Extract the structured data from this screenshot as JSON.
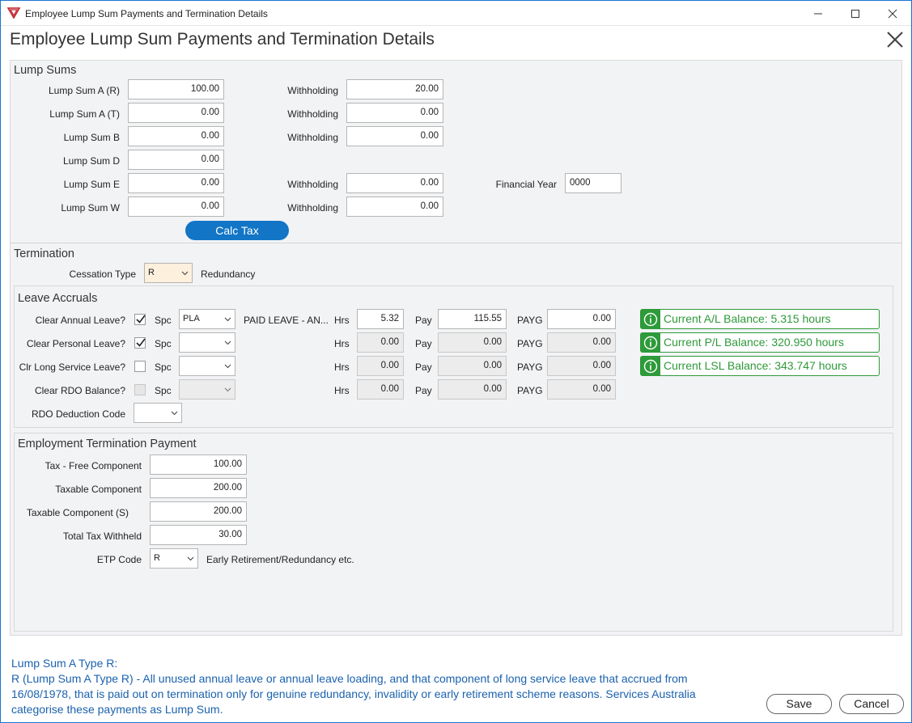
{
  "window": {
    "title": "Employee Lump Sum Payments and Termination Details"
  },
  "header": {
    "title": "Employee Lump Sum Payments and Termination Details"
  },
  "lump_sums": {
    "section_title": "Lump Sums",
    "rows": [
      {
        "label": "Lump Sum A (R)",
        "value": "100.00",
        "withholding_label": "Withholding",
        "withholding": "20.00"
      },
      {
        "label": "Lump Sum A (T)",
        "value": "0.00",
        "withholding_label": "Withholding",
        "withholding": "0.00"
      },
      {
        "label": "Lump Sum B",
        "value": "0.00",
        "withholding_label": "Withholding",
        "withholding": "0.00"
      },
      {
        "label": "Lump Sum D",
        "value": "0.00"
      },
      {
        "label": "Lump Sum E",
        "value": "0.00",
        "withholding_label": "Withholding",
        "withholding": "0.00"
      },
      {
        "label": "Lump Sum W",
        "value": "0.00",
        "withholding_label": "Withholding",
        "withholding": "0.00"
      }
    ],
    "financial_year_label": "Financial Year",
    "financial_year": "0000",
    "calc_tax_label": "Calc Tax"
  },
  "termination": {
    "section_title": "Termination",
    "cessation_type_label": "Cessation Type",
    "cessation_type": "R",
    "cessation_desc": "Redundancy"
  },
  "leave_accruals": {
    "section_title": "Leave Accruals",
    "spc_label": "Spc",
    "hrs_label": "Hrs",
    "pay_label": "Pay",
    "payg_label": "PAYG",
    "rows": [
      {
        "label": "Clear Annual Leave?",
        "checked": true,
        "spc": "PLA",
        "spc_desc": "PAID LEAVE - AN...",
        "hrs": "5.32",
        "pay": "115.55",
        "payg": "0.00",
        "balance": "Current A/L Balance: 5.315 hours"
      },
      {
        "label": "Clear Personal Leave?",
        "checked": true,
        "spc": "",
        "hrs": "0.00",
        "pay": "0.00",
        "payg": "0.00",
        "balance": "Current P/L Balance: 320.950 hours"
      },
      {
        "label": "Clr Long Service Leave?",
        "checked": false,
        "spc": "",
        "hrs": "0.00",
        "pay": "0.00",
        "payg": "0.00",
        "balance": "Current LSL Balance: 343.747 hours"
      },
      {
        "label": "Clear RDO Balance?",
        "checked": false,
        "spc": "",
        "hrs": "0.00",
        "pay": "0.00",
        "payg": "0.00"
      }
    ],
    "rdo_deduction_label": "RDO Deduction Code",
    "rdo_deduction": ""
  },
  "etp": {
    "section_title": "Employment Termination Payment",
    "rows": [
      {
        "label": "Tax - Free Component",
        "value": "100.00"
      },
      {
        "label": "Taxable Component",
        "value": "200.00"
      },
      {
        "label": "Taxable Component (S)",
        "value": "200.00"
      },
      {
        "label": "Total Tax Withheld",
        "value": "30.00"
      }
    ],
    "code_label": "ETP Code",
    "code": "R",
    "code_desc": "Early Retirement/Redundancy etc."
  },
  "help": {
    "heading": "Lump Sum A Type R:",
    "text": "R (Lump Sum A Type R) - All unused annual leave or annual leave loading, and that component of long service leave that accrued from 16/08/1978, that is paid out on termination only for genuine redundancy, invalidity or early retirement scheme reasons. Services Australia categorise these payments as Lump Sum."
  },
  "buttons": {
    "save": "Save",
    "cancel": "Cancel"
  },
  "colors": {
    "accent": "#1275c6",
    "success": "#2e9a3a",
    "help_text": "#1b62ad"
  }
}
